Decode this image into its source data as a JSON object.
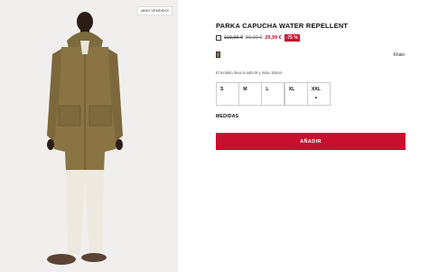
{
  "product": {
    "badge": "¡MÁS VENDIDO!",
    "title": "PARKA CAPUCHA WATER REPELLENT",
    "price": {
      "icon": "price-history-icon",
      "old_price_1": "119,99 €",
      "old_price_2": "59,99 €",
      "current_price": "29,99 €",
      "discount": "-75 %"
    },
    "color": {
      "swatch_hex": "#8a7444",
      "name": "Khaki"
    },
    "model_info": "El modelo lleva la talla M y mide 185cm.",
    "sizes": [
      {
        "label": "S"
      },
      {
        "label": "M"
      },
      {
        "label": "L"
      },
      {
        "label": "XL"
      },
      {
        "label": "XXL",
        "marker": "•"
      }
    ],
    "measures_label": "MEDIDAS",
    "add_label": "AÑADIR"
  },
  "colors": {
    "accent": "#c8102e",
    "photo_background": "#f0efed"
  }
}
